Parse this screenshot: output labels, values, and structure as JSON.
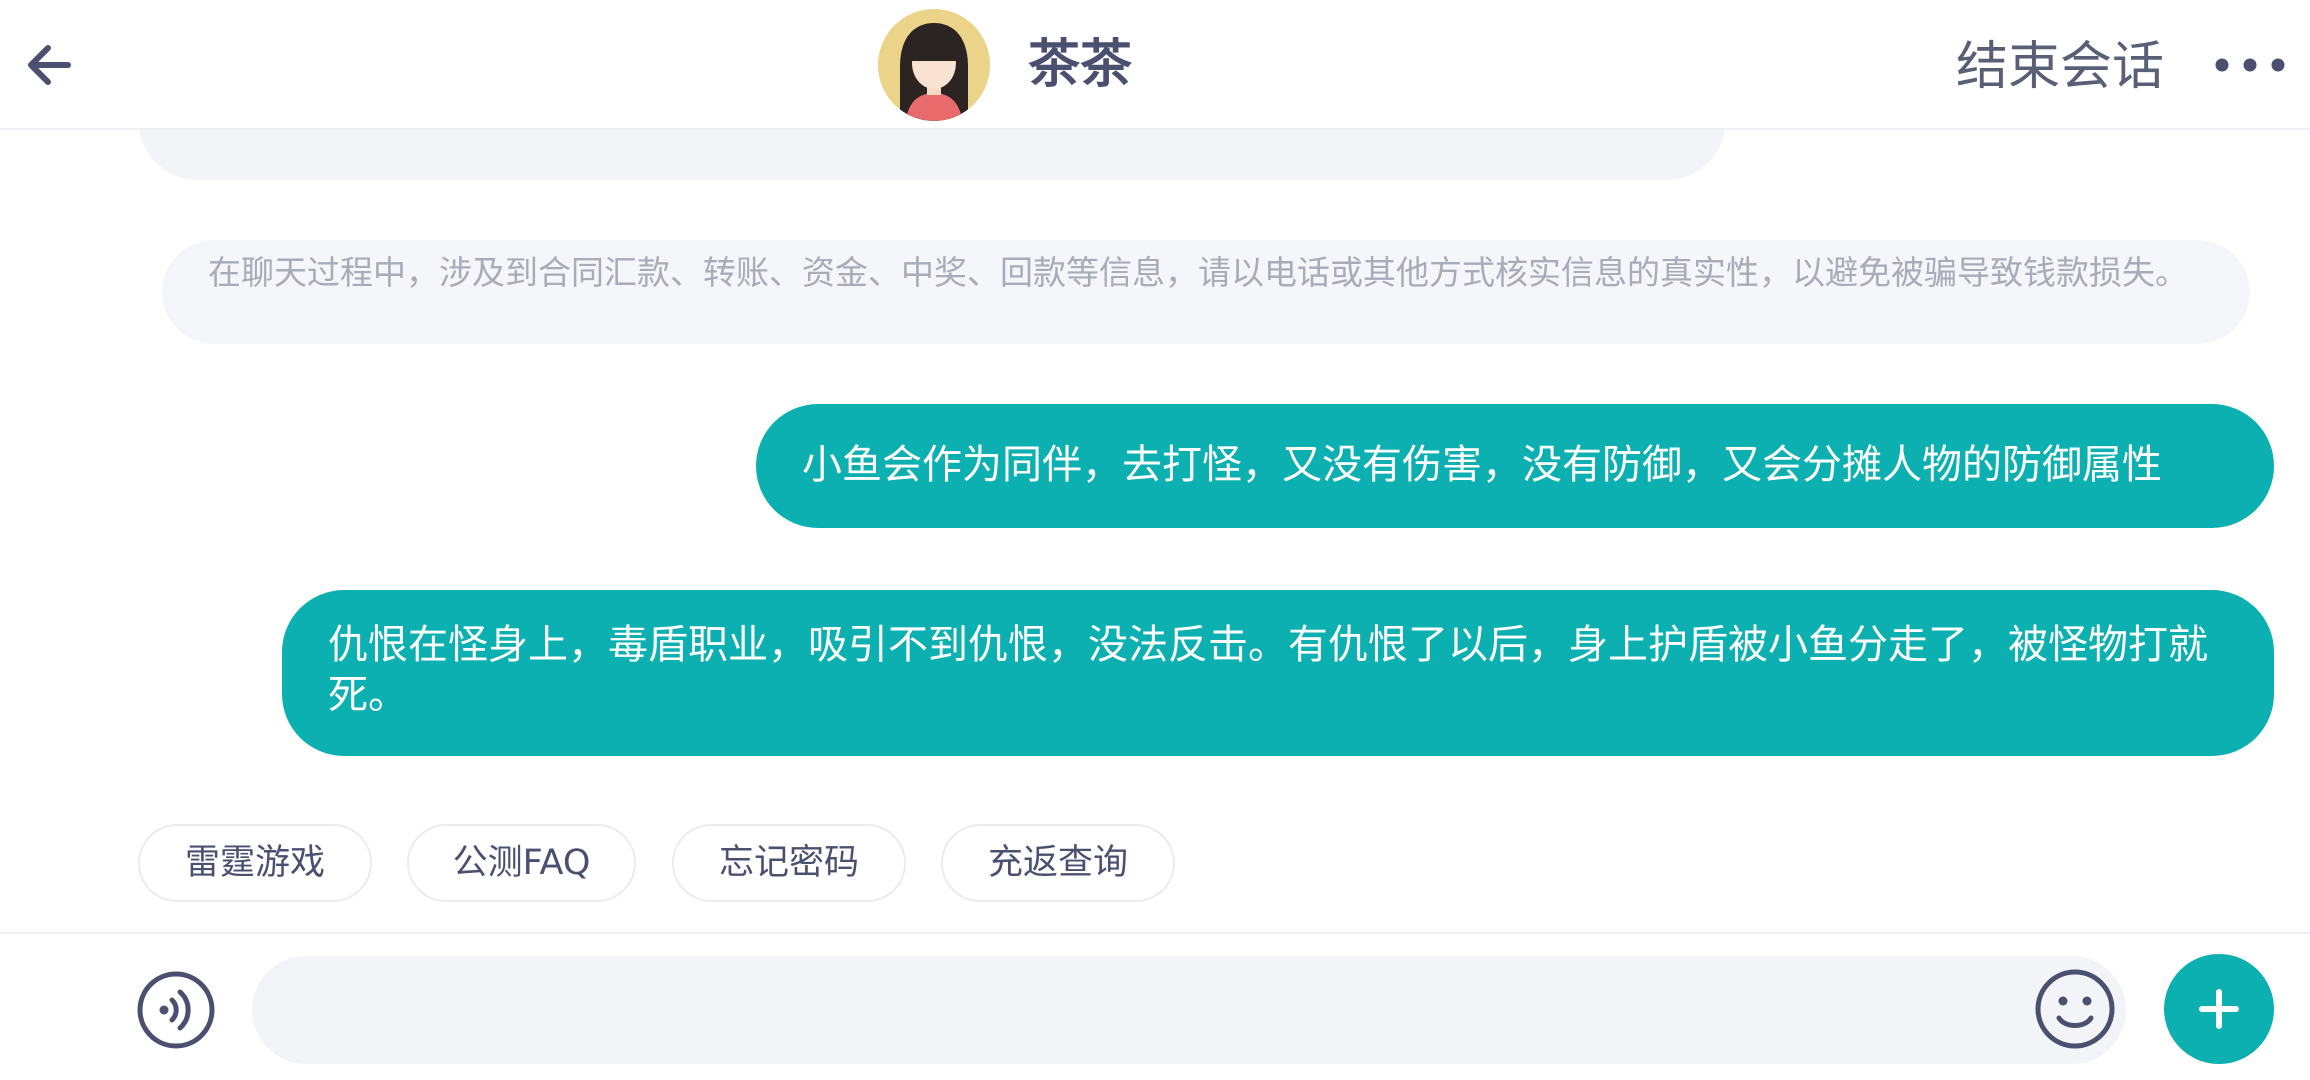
{
  "header": {
    "contact_name": "茶茶",
    "end_session_label": "结束会话",
    "icons": {
      "back": "back-arrow-icon",
      "avatar": "user-avatar",
      "more": "more-horizontal-icon"
    }
  },
  "chat": {
    "notice_text": "在聊天过程中，涉及到合同汇款、转账、资金、中奖、回款等信息，请以电话或其他方式核实信息的真实性，以避免被骗导致钱款损失。",
    "messages": [
      {
        "sender": "user",
        "text": "小鱼会作为同伴，去打怪，又没有伤害，没有防御，又会分摊人物的防御属性"
      },
      {
        "sender": "user",
        "text": "仇恨在怪身上，毒盾职业，吸引不到仇恨，没法反击。有仇恨了以后，身上护盾被小鱼分走了，被怪物打就死。"
      }
    ]
  },
  "quick_replies": [
    {
      "label": "雷霆游戏"
    },
    {
      "label": "公测FAQ"
    },
    {
      "label": "忘记密码"
    },
    {
      "label": "充返查询"
    }
  ],
  "input_bar": {
    "placeholder": "",
    "value": "",
    "icons": {
      "voice": "voice-input-icon",
      "emoji": "emoji-icon",
      "plus": "plus-icon"
    }
  },
  "colors": {
    "accent": "#0db0b0",
    "bubble_gray": "#f2f4f7",
    "notice_text": "#a8abb8",
    "header_text": "#4b5070"
  }
}
